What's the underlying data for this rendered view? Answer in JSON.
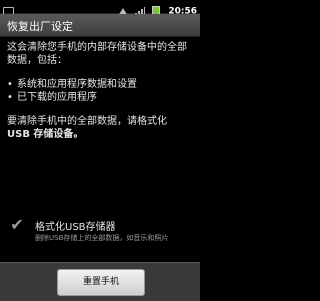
{
  "status_bar": {
    "time": "20:56",
    "icons": [
      "usb-icon",
      "wifi-icon",
      "signal-icon",
      "battery-icon"
    ]
  },
  "header": {
    "title": "恢复出厂设定"
  },
  "main": {
    "intro": "这会清除您手机的内部存储设备中的全部数据，包括：",
    "bullets": [
      "系统和应用程序数据和设置",
      "已下载的应用程序"
    ],
    "instruction_line1": "要清除手机中的全部数据，请格式化",
    "instruction_line2": "USB 存储设备。"
  },
  "checkbox": {
    "label": "格式化USB存储器",
    "subtitle": "删除USB存储上的全部数据，如音乐和照片",
    "checked": true
  },
  "footer": {
    "reset_button": "重置手机"
  },
  "colors": {
    "title_bar": "#4a4a4a",
    "button_bar": "#3a3a3a",
    "battery": "#7fc13b"
  }
}
